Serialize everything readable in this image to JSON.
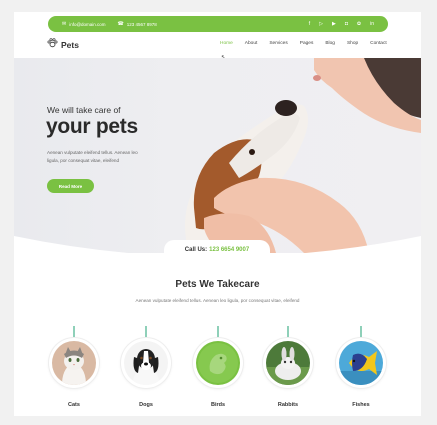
{
  "topbar": {
    "email": "info@domain.com",
    "phone": "123 4567 8978",
    "socials": [
      "facebook-icon",
      "twitter-icon",
      "youtube-icon",
      "instagram-icon",
      "pinterest-icon",
      "linkedin-icon"
    ]
  },
  "header": {
    "logo": "Pets",
    "nav": [
      "Home",
      "About",
      "Services",
      "Pages",
      "Blog",
      "Shop",
      "Contact"
    ],
    "active_nav": "Home"
  },
  "hero": {
    "subtitle": "We will take care of",
    "title": "your pets",
    "text_line1": "Aenean vulputate eleifend tellus. Aenean leo",
    "text_line2": "ligula, por consequat vitae, eleifend",
    "button": "Read More"
  },
  "call": {
    "label": "Call Us:",
    "number": "123 6654 9007"
  },
  "section": {
    "title": "Pets We Takecare",
    "subtitle": "Aenean vulputate eleifend tellus. Aenean leo ligula, por consequat vitae, eleifend"
  },
  "pets": [
    "Cats",
    "Dogs",
    "Birds",
    "Rabbits",
    "Fishes"
  ],
  "colors": {
    "accent": "#7ac142",
    "stem": "#8fd0b9"
  }
}
